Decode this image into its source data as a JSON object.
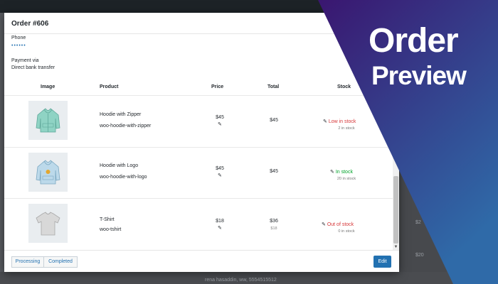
{
  "background": {
    "row_texts": [
      "$2",
      "$20",
      "$2"
    ],
    "bottom_text": "rena hasaddin, ww, 5554515512"
  },
  "modal": {
    "title": "Order #606",
    "phone_label": "Phone",
    "phone_value": "••••••",
    "payment_label": "Payment via",
    "payment_value": "Direct bank transfer",
    "columns": [
      "Image",
      "Product",
      "Price",
      "Total",
      "Stock"
    ],
    "items": [
      {
        "name": "Hoodie with Zipper",
        "sku": "woo-hoodie-with-zipper",
        "price": "$45",
        "total": "$45",
        "total_sub": "",
        "stock_status": "Low in stock",
        "stock_count": "2 in stock",
        "stock_color": "#d63638"
      },
      {
        "name": "Hoodie with Logo",
        "sku": "woo-hoodie-with-logo",
        "price": "$45",
        "total": "$45",
        "total_sub": "",
        "stock_status": "In stock",
        "stock_count": "20 in stock",
        "stock_color": "#00a32a"
      },
      {
        "name": "T-Shirt",
        "sku": "woo-tshirt",
        "price": "$18",
        "total": "$36",
        "total_sub": "$18",
        "stock_status": "Out of stock",
        "stock_count": "0 in stock",
        "stock_color": "#d63638"
      }
    ],
    "buttons": {
      "processing": "Processing",
      "completed": "Completed",
      "edit": "Edit"
    }
  },
  "promo": {
    "line1": "Order",
    "line2": "Preview"
  },
  "colors": {
    "accent": "#2271b1",
    "low_stock": "#d63638",
    "in_stock": "#00a32a",
    "promo_gradient_start": "#3a1670",
    "promo_gradient_end": "#2f6aa8"
  }
}
